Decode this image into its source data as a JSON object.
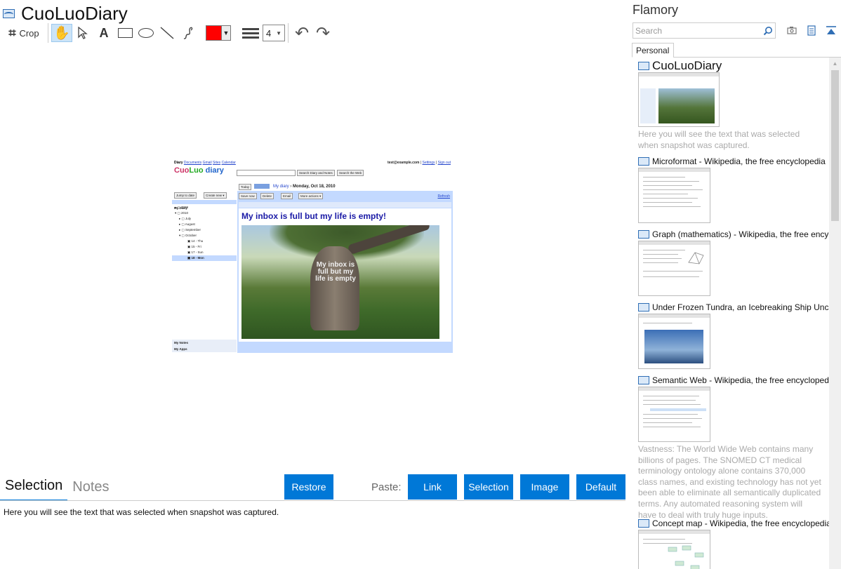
{
  "main": {
    "doc_title": "CuoLuoDiary",
    "toolbar": {
      "crop_label": "Crop",
      "line_width": "4",
      "stroke_color": "#ff0000"
    },
    "snapshot": {
      "nav": [
        "Diary",
        "Documents",
        "Gmail",
        "Sites",
        "Calendar"
      ],
      "account": "test@example.com",
      "account_links": [
        "Settings",
        "Sign out"
      ],
      "logo_a": "Cuo",
      "logo_b": "Luo",
      "logo_c": "diary",
      "search_btn_1": "Search Diary and Notes",
      "search_btn_2": "Search the Web",
      "today_btn": "Today",
      "crumb_link": "My diary",
      "crumb_date": "Monday, Oct 18, 2010",
      "jump_btn": "Jump to date",
      "create_btn": "Create new ▾",
      "save_btn": "Save now",
      "delete_btn": "Delete",
      "email_btn": "Email",
      "more_btn": "More actions ▾",
      "refresh_link": "Refresh",
      "tree_header": "My Diary",
      "tree": [
        "2008",
        "2010",
        "July",
        "August",
        "September",
        "October",
        "14 - Thu",
        "15 - Fri",
        "17 - Sun",
        "18 - Mon"
      ],
      "notes_label": "My Notes",
      "apps_label": "My Apps",
      "heading": "My inbox is full but my life is empty!",
      "tree_text": "My inbox is full but my life is empty"
    },
    "tabs": {
      "selection": "Selection",
      "notes": "Notes"
    },
    "buttons": {
      "restore": "Restore",
      "paste_label": "Paste:",
      "link": "Link",
      "selection": "Selection",
      "image": "Image",
      "default": "Default"
    },
    "selection_text": "Here you will see the text that was selected when snapshot was captured."
  },
  "side": {
    "title": "Flamory",
    "search_placeholder": "Search",
    "tab": "Personal",
    "items": [
      {
        "title": "CuoLuoDiary",
        "desc": "Here you will see the text that was selected when snapshot was captured."
      },
      {
        "title": "Microformat - Wikipedia, the free encyclopedia",
        "desc": ""
      },
      {
        "title": "Graph (mathematics) - Wikipedia, the free encyclopedia",
        "desc": ""
      },
      {
        "title": "Under Frozen Tundra, an Icebreaking Ship Uncovers Ancient Secrets",
        "desc": ""
      },
      {
        "title": "Semantic Web - Wikipedia, the free encyclopedia",
        "desc": "Vastness: The World Wide Web contains many billions of pages. The SNOMED CT medical terminology ontology alone contains 370,000 class names, and existing technology has not yet been able to eliminate all semantically duplicated terms. Any automated reasoning system will have to deal with truly huge inputs."
      },
      {
        "title": "Concept map - Wikipedia, the free encyclopedia",
        "desc": ""
      }
    ]
  },
  "icons": {
    "crop": "crop-icon",
    "hand": "hand-icon",
    "pointer": "pointer-icon",
    "text": "text-icon",
    "rectangle": "rectangle-icon",
    "ellipse": "ellipse-icon",
    "line": "line-icon",
    "freehand": "freehand-icon",
    "undo": "undo-icon",
    "redo": "redo-icon",
    "search": "search-icon",
    "camera": "camera-icon",
    "document": "document-icon",
    "collapse": "collapse-icon"
  }
}
